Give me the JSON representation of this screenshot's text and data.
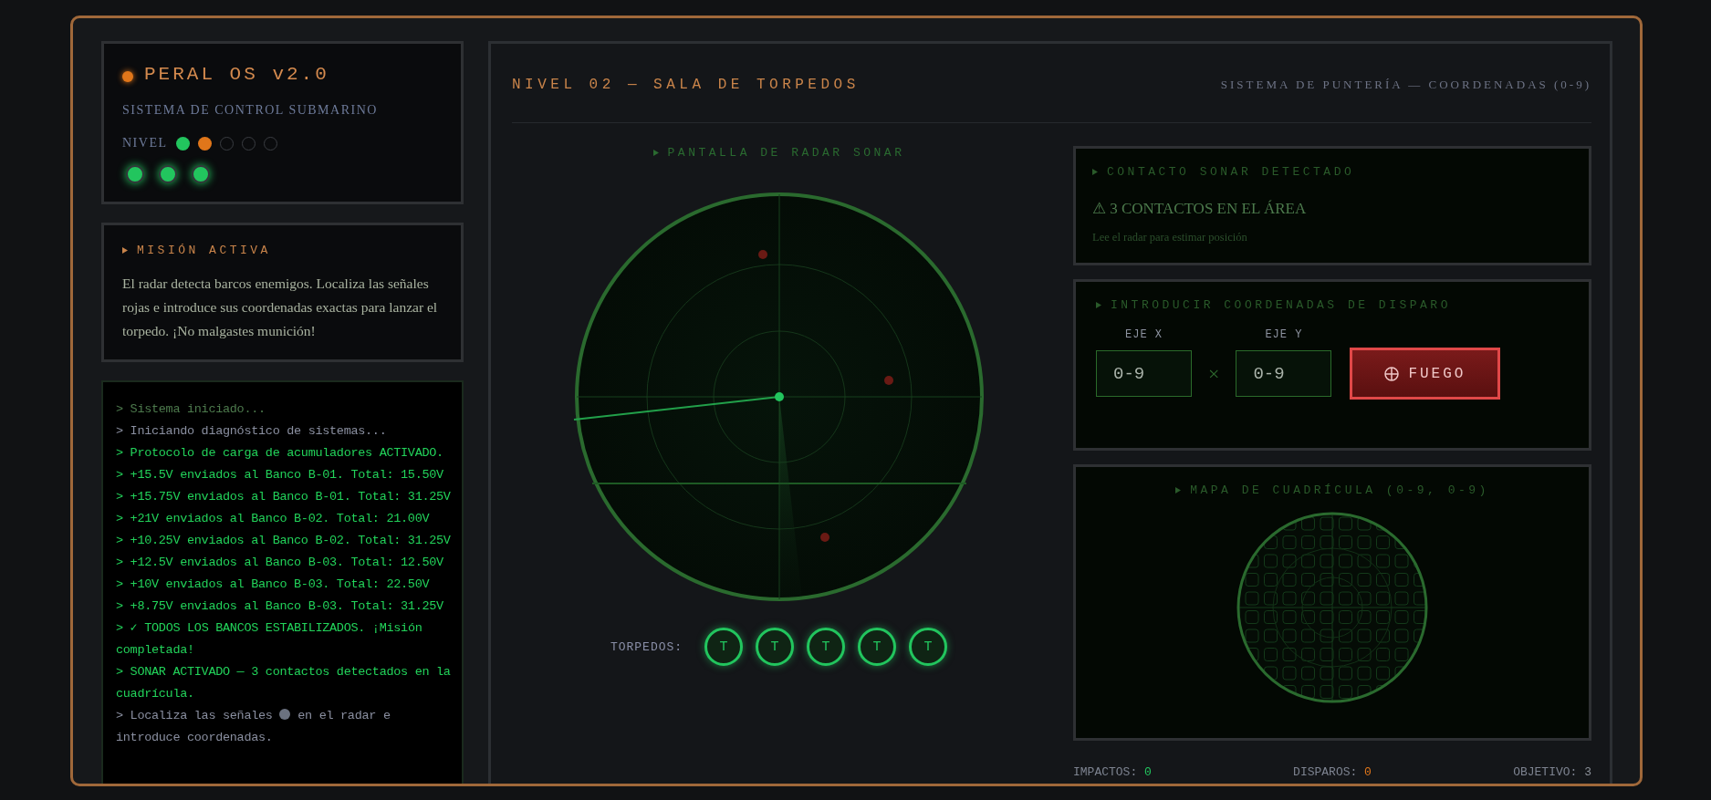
{
  "sidebar": {
    "status": {
      "title": "PERAL OS v2.0",
      "subtitle": "SISTEMA DE CONTROL SUBMARINO",
      "level_label": "NIVEL",
      "levels": [
        {
          "kind": "done"
        },
        {
          "kind": "current"
        },
        {
          "kind": "locked"
        },
        {
          "kind": "locked"
        },
        {
          "kind": "locked"
        }
      ],
      "lights": [
        {
          "on": true
        },
        {
          "on": true
        },
        {
          "on": true
        }
      ]
    },
    "mission": {
      "title": "MISIÓN ACTIVA",
      "text": "El radar detecta barcos enemigos. Localiza las señales rojas e introduce sus coordenadas exactas para lanzar el torpedo. ¡No malgastes munición!"
    },
    "log": [
      {
        "kind": "dim",
        "text": "> Sistema iniciado..."
      },
      {
        "kind": "info",
        "text": "> Iniciando diagnóstico de sistemas..."
      },
      {
        "kind": "ok",
        "text": "> Protocolo de carga de acumuladores ACTIVADO."
      },
      {
        "kind": "ok",
        "text": "> +15.5V enviados al Banco B-01. Total: 15.50V"
      },
      {
        "kind": "ok",
        "text": "> +15.75V enviados al Banco B-01. Total: 31.25V"
      },
      {
        "kind": "ok",
        "text": "> +21V enviados al Banco B-02. Total: 21.00V"
      },
      {
        "kind": "ok",
        "text": "> +10.25V enviados al Banco B-02. Total: 31.25V"
      },
      {
        "kind": "ok",
        "text": "> +12.5V enviados al Banco B-03. Total: 12.50V"
      },
      {
        "kind": "ok",
        "text": "> +10V enviados al Banco B-03. Total: 22.50V"
      },
      {
        "kind": "ok",
        "text": "> +8.75V enviados al Banco B-03. Total: 31.25V"
      },
      {
        "kind": "ok",
        "text": "> ✓ TODOS LOS BANCOS ESTABILIZADOS. ¡Misión completada!"
      },
      {
        "kind": "ok",
        "text": "> SONAR ACTIVADO — 3 contactos detectados en la cuadrícula."
      },
      {
        "kind": "info",
        "text": "> Localiza las señales",
        "after": "en el radar e introduce coordenadas."
      }
    ]
  },
  "main": {
    "title": "NIVEL 02 — SALA DE TORPEDOS",
    "subtitle": "SISTEMA DE PUNTERÍA — COORDENADAS (0-9)",
    "radar": {
      "label": "PANTALLA DE RADAR SONAR",
      "torpedo_label": "TORPEDOS:",
      "torpedoes": [
        {
          "text": "T",
          "loaded": true
        },
        {
          "text": "T",
          "loaded": true
        },
        {
          "text": "T",
          "loaded": true
        },
        {
          "text": "T",
          "loaded": true
        },
        {
          "text": "T",
          "loaded": true
        }
      ]
    },
    "contact": {
      "title": "CONTACTO SONAR DETECTADO",
      "alert": "⚠ 3 CONTACTOS EN EL ÁREA",
      "hint": "Lee el radar para estimar posición"
    },
    "fire": {
      "title": "INTRODUCIR COORDENADAS DE DISPARO",
      "x_label": "EJE X",
      "x_placeholder": "0-9",
      "times": "×",
      "y_label": "EJE Y",
      "y_placeholder": "0-9",
      "button": "FUEGO"
    },
    "grid_map": {
      "title": "MAPA DE CUADRÍCULA (0-9, 0-9)"
    },
    "stats": [
      {
        "label": "IMPACTOS:",
        "value": "0",
        "color": "#22c55e"
      },
      {
        "label": "DISPAROS:",
        "value": "0",
        "color": "#e0761a"
      },
      {
        "label": "OBJETIVO:",
        "value": "3",
        "color": "#8a8f98"
      }
    ]
  }
}
